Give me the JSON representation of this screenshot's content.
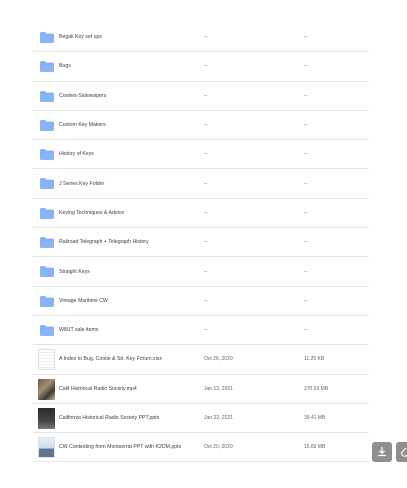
{
  "rows": [
    {
      "name": "Begali Key set ups",
      "modified": "--",
      "size": "--",
      "kind": "folder"
    },
    {
      "name": "Bugs",
      "modified": "--",
      "size": "--",
      "kind": "folder"
    },
    {
      "name": "Cooties-Sideswipers",
      "modified": "--",
      "size": "--",
      "kind": "folder"
    },
    {
      "name": "Custom Key Makers",
      "modified": "--",
      "size": "--",
      "kind": "folder"
    },
    {
      "name": "History of Keys",
      "modified": "--",
      "size": "--",
      "kind": "folder"
    },
    {
      "name": "J Series Key Folder",
      "modified": "--",
      "size": "--",
      "kind": "folder"
    },
    {
      "name": "Keying Techniques & Advice",
      "modified": "--",
      "size": "--",
      "kind": "folder"
    },
    {
      "name": "Railroad Telegraph + Telegraph History",
      "modified": "--",
      "size": "--",
      "kind": "folder"
    },
    {
      "name": "Straight Keys",
      "modified": "--",
      "size": "--",
      "kind": "folder"
    },
    {
      "name": "Vintage Maritime CW",
      "modified": "--",
      "size": "--",
      "kind": "folder"
    },
    {
      "name": "W8UT sale items",
      "modified": "--",
      "size": "--",
      "kind": "folder"
    },
    {
      "name": "A Index to Bug, Cootie & Str. Key Forum.xlsx",
      "modified": "Oct 26, 2020",
      "size": "11.25 KB",
      "kind": "sheet"
    },
    {
      "name": "Calif Historical Radio Society.mp4",
      "modified": "Jan 13, 2021",
      "size": "270.93 MB",
      "kind": "photo"
    },
    {
      "name": "California Historical Radio Society PPT.pptx",
      "modified": "Jan 22, 2021",
      "size": "39.41 MB",
      "kind": "dark"
    },
    {
      "name": "CW Contesting from Montserrat PPT with K2DM.pptx",
      "modified": "Oct 20, 2020",
      "size": "15.82 MB",
      "kind": "slide"
    }
  ],
  "actions": {
    "download_icon": "download-icon",
    "link_icon": "link-icon"
  },
  "colors": {
    "folder": "#8ab4f8",
    "folder_tab": "#7aa7ee",
    "divider": "#e6e6e6",
    "fab": "#8f8f8f"
  }
}
